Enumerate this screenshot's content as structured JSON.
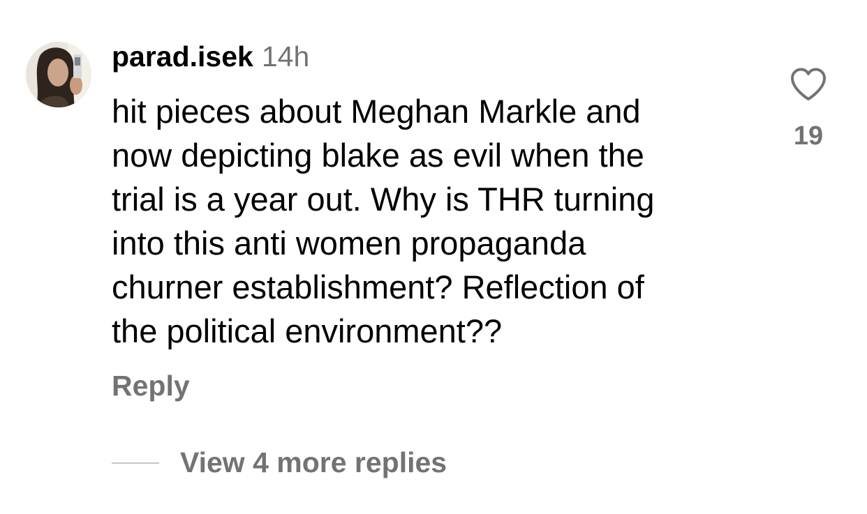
{
  "comment": {
    "username": "parad.isek",
    "time": "14h",
    "lines": [
      "hit pieces about Meghan Markle and",
      "now depicting blake as evil when the",
      "trial is a year out. Why is THR turning",
      "into this anti women propaganda",
      "churner establishment? Reflection of",
      "the political environment??"
    ],
    "reply_label": "Reply",
    "like_count": "19",
    "view_replies_label": "View 4 more replies",
    "icons": {
      "like": "heart-outline-icon",
      "avatar": "profile-photo"
    },
    "colors": {
      "text": "#000000",
      "secondary": "#737373",
      "divider": "#c7c7c7"
    }
  }
}
